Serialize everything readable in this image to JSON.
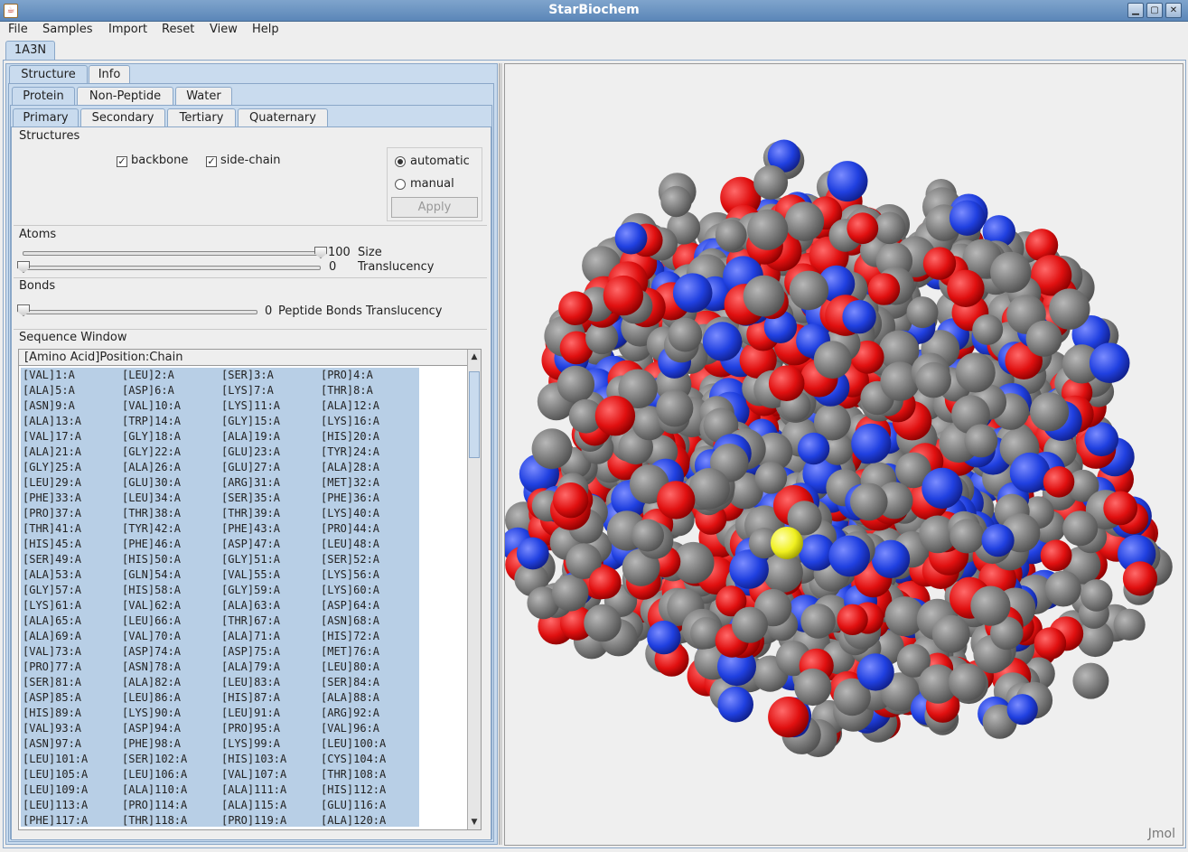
{
  "window": {
    "title": "StarBiochem"
  },
  "menu": [
    "File",
    "Samples",
    "Import",
    "Reset",
    "View",
    "Help"
  ],
  "document_tab": "1A3N",
  "tabs": {
    "level1": [
      "Structure",
      "Info"
    ],
    "level2": [
      "Protein",
      "Non-Peptide",
      "Water"
    ],
    "level3": [
      "Primary",
      "Secondary",
      "Tertiary",
      "Quaternary"
    ]
  },
  "structures": {
    "label": "Structures",
    "backbone_label": "backbone",
    "sidechain_label": "side-chain",
    "backbone_checked": true,
    "sidechain_checked": true,
    "mode_automatic": "automatic",
    "mode_manual": "manual",
    "selected_mode": "automatic",
    "apply_label": "Apply"
  },
  "atoms": {
    "label": "Atoms",
    "size_value": "100",
    "size_label": "Size",
    "translucency_value": "0",
    "translucency_label": "Translucency"
  },
  "bonds": {
    "label": "Bonds",
    "value": "0",
    "translucency_label": "Peptide Bonds Translucency"
  },
  "sequence": {
    "label": "Sequence Window",
    "header": "[Amino Acid]Position:Chain",
    "rows": [
      [
        "[VAL]1:A",
        "[LEU]2:A",
        "[SER]3:A",
        "[PRO]4:A"
      ],
      [
        "[ALA]5:A",
        "[ASP]6:A",
        "[LYS]7:A",
        "[THR]8:A"
      ],
      [
        "[ASN]9:A",
        "[VAL]10:A",
        "[LYS]11:A",
        "[ALA]12:A"
      ],
      [
        "[ALA]13:A",
        "[TRP]14:A",
        "[GLY]15:A",
        "[LYS]16:A"
      ],
      [
        "[VAL]17:A",
        "[GLY]18:A",
        "[ALA]19:A",
        "[HIS]20:A"
      ],
      [
        "[ALA]21:A",
        "[GLY]22:A",
        "[GLU]23:A",
        "[TYR]24:A"
      ],
      [
        "[GLY]25:A",
        "[ALA]26:A",
        "[GLU]27:A",
        "[ALA]28:A"
      ],
      [
        "[LEU]29:A",
        "[GLU]30:A",
        "[ARG]31:A",
        "[MET]32:A"
      ],
      [
        "[PHE]33:A",
        "[LEU]34:A",
        "[SER]35:A",
        "[PHE]36:A"
      ],
      [
        "[PRO]37:A",
        "[THR]38:A",
        "[THR]39:A",
        "[LYS]40:A"
      ],
      [
        "[THR]41:A",
        "[TYR]42:A",
        "[PHE]43:A",
        "[PRO]44:A"
      ],
      [
        "[HIS]45:A",
        "[PHE]46:A",
        "[ASP]47:A",
        "[LEU]48:A"
      ],
      [
        "[SER]49:A",
        "[HIS]50:A",
        "[GLY]51:A",
        "[SER]52:A"
      ],
      [
        "[ALA]53:A",
        "[GLN]54:A",
        "[VAL]55:A",
        "[LYS]56:A"
      ],
      [
        "[GLY]57:A",
        "[HIS]58:A",
        "[GLY]59:A",
        "[LYS]60:A"
      ],
      [
        "[LYS]61:A",
        "[VAL]62:A",
        "[ALA]63:A",
        "[ASP]64:A"
      ],
      [
        "[ALA]65:A",
        "[LEU]66:A",
        "[THR]67:A",
        "[ASN]68:A"
      ],
      [
        "[ALA]69:A",
        "[VAL]70:A",
        "[ALA]71:A",
        "[HIS]72:A"
      ],
      [
        "[VAL]73:A",
        "[ASP]74:A",
        "[ASP]75:A",
        "[MET]76:A"
      ],
      [
        "[PRO]77:A",
        "[ASN]78:A",
        "[ALA]79:A",
        "[LEU]80:A"
      ],
      [
        "[SER]81:A",
        "[ALA]82:A",
        "[LEU]83:A",
        "[SER]84:A"
      ],
      [
        "[ASP]85:A",
        "[LEU]86:A",
        "[HIS]87:A",
        "[ALA]88:A"
      ],
      [
        "[HIS]89:A",
        "[LYS]90:A",
        "[LEU]91:A",
        "[ARG]92:A"
      ],
      [
        "[VAL]93:A",
        "[ASP]94:A",
        "[PRO]95:A",
        "[VAL]96:A"
      ],
      [
        "[ASN]97:A",
        "[PHE]98:A",
        "[LYS]99:A",
        "[LEU]100:A"
      ],
      [
        "[LEU]101:A",
        "[SER]102:A",
        "[HIS]103:A",
        "[CYS]104:A"
      ],
      [
        "[LEU]105:A",
        "[LEU]106:A",
        "[VAL]107:A",
        "[THR]108:A"
      ],
      [
        "[LEU]109:A",
        "[ALA]110:A",
        "[ALA]111:A",
        "[HIS]112:A"
      ],
      [
        "[LEU]113:A",
        "[PRO]114:A",
        "[ALA]115:A",
        "[GLU]116:A"
      ],
      [
        "[PHE]117:A",
        "[THR]118:A",
        "[PRO]119:A",
        "[ALA]120:A"
      ]
    ]
  },
  "viewer": {
    "watermark": "Jmol",
    "atom_colors": {
      "carbon": "#7a7a7a",
      "oxygen": "#e01010",
      "nitrogen": "#2040e0",
      "sulfur": "#f0f020"
    }
  }
}
